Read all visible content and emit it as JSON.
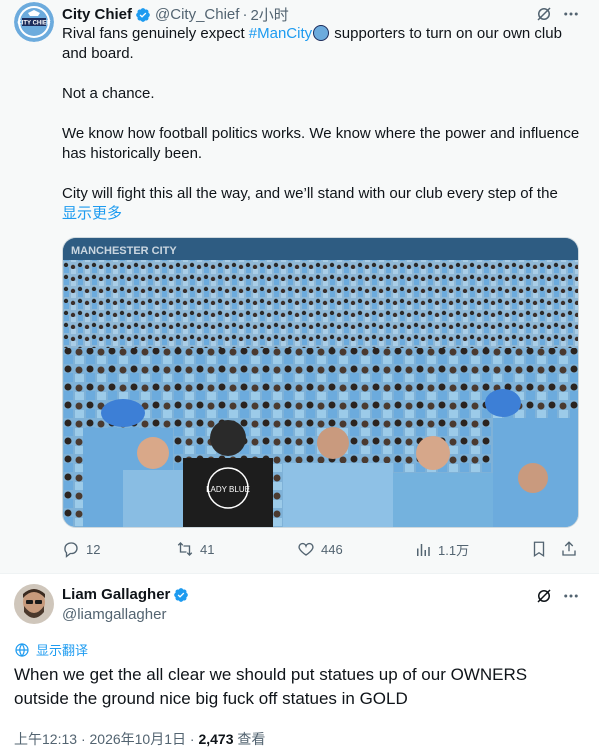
{
  "tweet": {
    "display_name": "City Chief",
    "handle": "@City_Chief",
    "separator": "·",
    "time": "2小时",
    "avatar_icon": "city-chief-logo-icon",
    "line1_pre": "Rival fans genuinely expect ",
    "hashtag": "#ManCity",
    "line1_post": " supporters to turn on our own club and board.",
    "para2": "Not a chance.",
    "para3": "We know how football politics works. We know where the power and influence has historically been.",
    "para4": "City will fight this all the way, and we’ll stand with our club every step of the",
    "show_more": "显示更多",
    "image_banner": "MANCHESTER CITY",
    "image_shirt_text": "LADY BLUE",
    "actions": {
      "replies": "12",
      "retweets": "41",
      "likes": "446",
      "views": "1.1万"
    }
  },
  "reply": {
    "display_name": "Liam Gallagher",
    "handle": "@liamgallagher",
    "translate_label": "显示翻译",
    "text": "When we get the all clear we should put statues up of our OWNERS outside the ground nice big fuck off statues in GOLD",
    "time": "上午12:13",
    "separator": "·",
    "date": "2026年10月1日",
    "separator2": "·",
    "views_count": "2,473",
    "views_label": "查看"
  },
  "colors": {
    "accent": "#1d9bf0",
    "verified": "#1d9bf0",
    "muted": "#536471",
    "city_blue": "#6cabdd"
  }
}
